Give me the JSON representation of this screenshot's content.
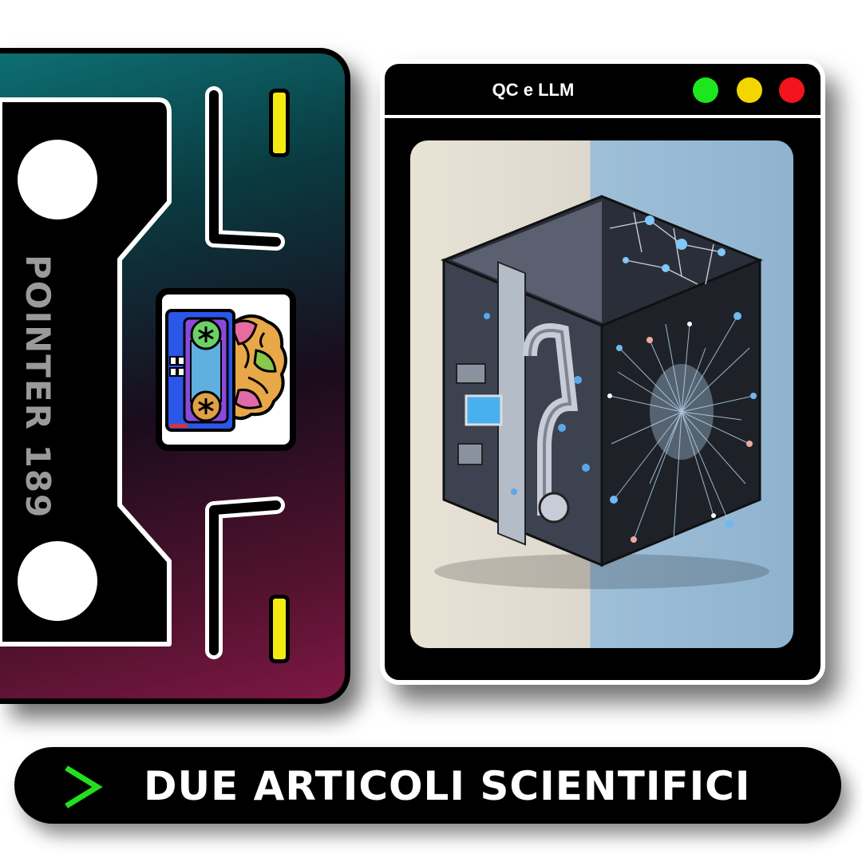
{
  "cassette": {
    "label": "POINTER 189",
    "logo_icon": "cassette-brain-logo"
  },
  "window": {
    "title": "QC e LLM",
    "controls": {
      "green": "#1ee61e",
      "yellow": "#f2d600",
      "red": "#f2141e"
    },
    "image": "quantum-computer-cube-illustration"
  },
  "banner": {
    "icon": "chevron-right-icon",
    "text": "DUE ARTICOLI SCIENTIFICI",
    "icon_color": "#22e01b"
  }
}
